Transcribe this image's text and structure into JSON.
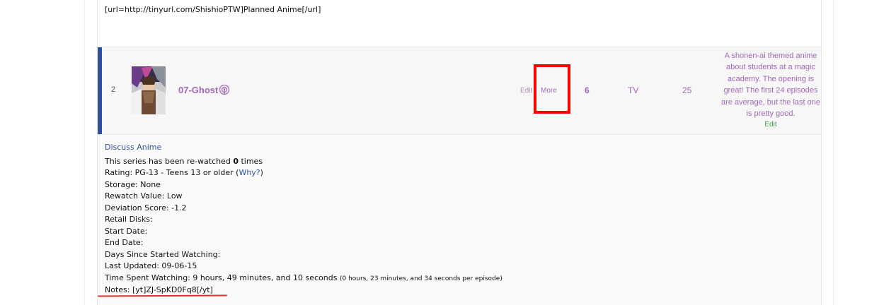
{
  "previous_row": {
    "notes_text": "[url=http://tinyurl.com/ShishioPTW]Planned Anime[/url]"
  },
  "anime_row": {
    "rank": "2",
    "title": "07-Ghost",
    "title_icon": "podcast-icon",
    "edit_label": "Edit",
    "separator": "-",
    "more_label": "More",
    "score": "6",
    "type": "TV",
    "episodes": "25",
    "comment": "A shonen-ai themed anime about students at a magic academy. The opening is great! The first 24 episodes are average, but the last one is pretty good.",
    "comment_edit_label": "Edit",
    "accent_color": "#2c4f9e",
    "link_color": "#a267b8"
  },
  "details": {
    "discuss_label": "Discuss Anime",
    "rewatch_prefix": "This series has been re-watched ",
    "rewatch_count": "0",
    "rewatch_suffix": " times",
    "rating_text": "Rating: PG-13 - Teens 13 or older (",
    "why_label": "Why?",
    "rating_close": ")",
    "storage": "Storage: None",
    "rewatch_value": "Rewatch Value: Low",
    "deviation": "Deviation Score: -1.2",
    "retail": "Retail Disks:",
    "start_date": "Start Date:",
    "end_date": "End Date:",
    "days_since": "Days Since Started Watching:",
    "last_updated": "Last Updated: 09-06-15",
    "time_spent": "Time Spent Watching: 9 hours, 49 minutes, and 10 seconds",
    "time_per_episode": "(0 hours, 23 minutes, and 34 seconds per episode)",
    "notes": "Notes: [yt]ZJ-SpKD0Fq8[/yt]"
  },
  "annotations": {
    "highlight_color": "#ff0000",
    "underline_color": "#e23030"
  }
}
